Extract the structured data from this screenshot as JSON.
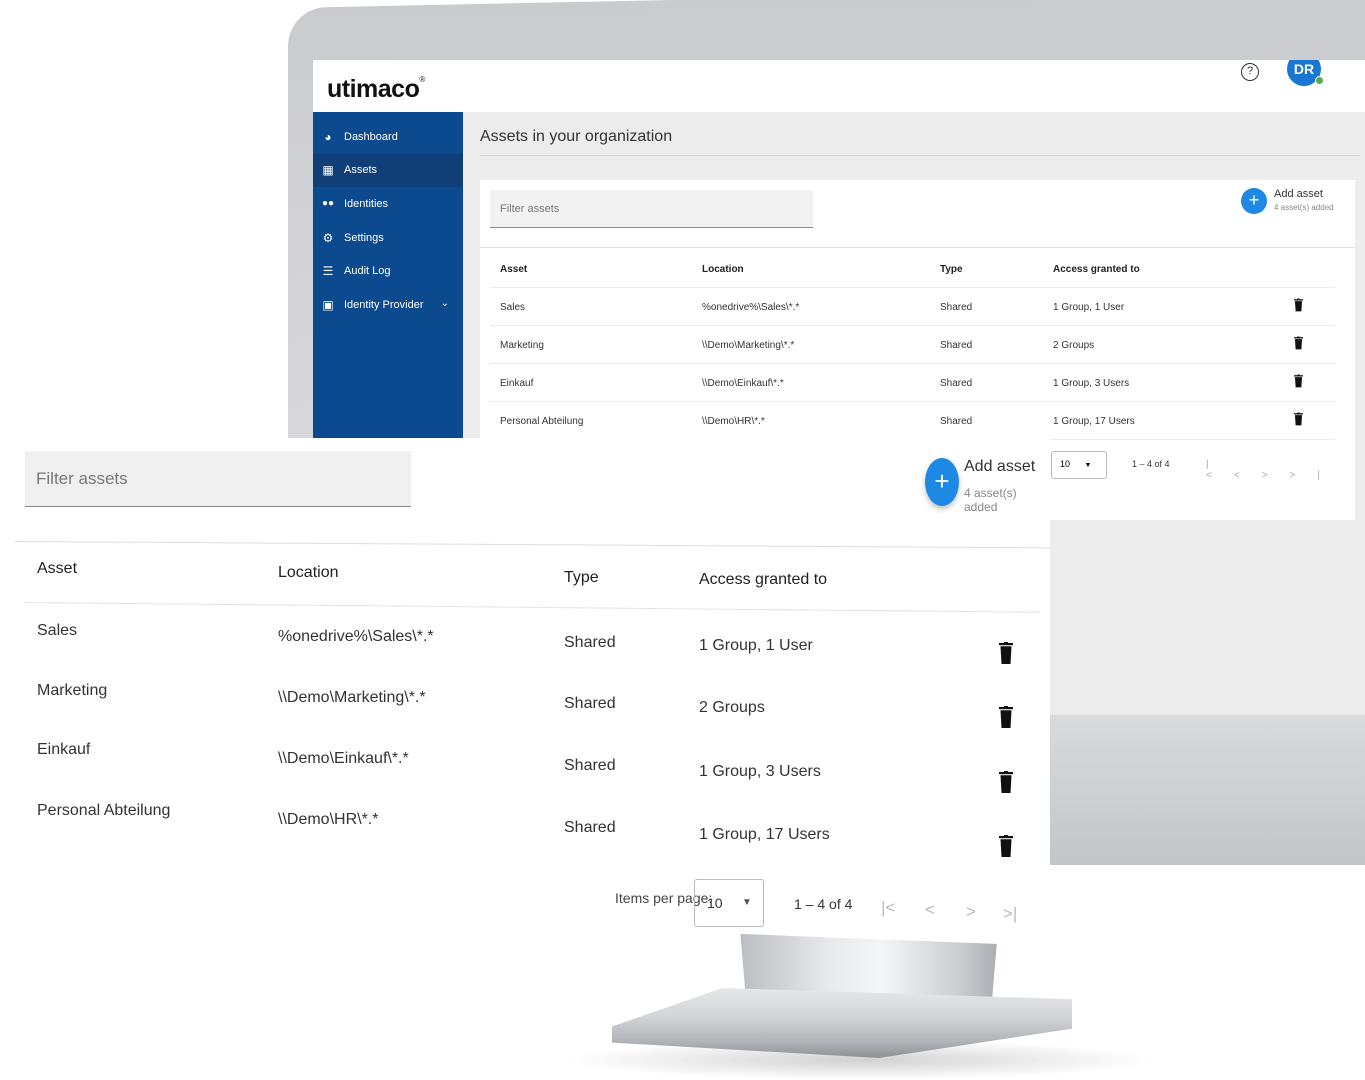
{
  "brand": {
    "name": "utimaco",
    "mark": "®"
  },
  "topbar": {
    "help_icon": "help-circle-icon",
    "avatar_initials": "DR",
    "status_color": "#4caf50"
  },
  "sidebar": {
    "items": [
      {
        "label": "Dashboard",
        "icon": "pie-chart-icon",
        "glyph": "◕"
      },
      {
        "label": "Assets",
        "icon": "assets-icon",
        "glyph": "▦",
        "active": true
      },
      {
        "label": "Identities",
        "icon": "people-icon",
        "glyph": "👥"
      },
      {
        "label": "Settings",
        "icon": "gear-icon",
        "glyph": "⚙"
      },
      {
        "label": "Audit Log",
        "icon": "list-icon",
        "glyph": "☰"
      },
      {
        "label": "Identity Provider",
        "icon": "id-badge-icon",
        "glyph": "▣",
        "chevron": "⌄"
      }
    ]
  },
  "page": {
    "title": "Assets in your organization"
  },
  "toolbar": {
    "filter_placeholder": "Filter assets",
    "add_label": "Add asset",
    "add_sub": "4 asset(s) added",
    "add_icon": "+"
  },
  "table": {
    "headers": [
      "Asset",
      "Location",
      "Type",
      "Access granted to"
    ],
    "rows": [
      {
        "asset": "Sales",
        "location": "%onedrive%\\Sales\\*.*",
        "type": "Shared",
        "access": "1 Group, 1 User"
      },
      {
        "asset": "Marketing",
        "location": "\\\\Demo\\Marketing\\*.*",
        "type": "Shared",
        "access": "2 Groups"
      },
      {
        "asset": "Einkauf",
        "location": "\\\\Demo\\Einkauf\\*.*",
        "type": "Shared",
        "access": "1 Group, 3 Users"
      },
      {
        "asset": "Personal Abteilung",
        "location": "\\\\Demo\\HR\\*.*",
        "type": "Shared",
        "access": "1 Group, 17 Users"
      }
    ]
  },
  "pagination": {
    "items_per_page_label": "Items per page:",
    "page_size": "10",
    "dropdown_arrow": "▼",
    "range": "1 – 4 of 4",
    "first_icon": "|<",
    "prev_icon": "<",
    "next_icon": ">",
    "last_icon": ">|"
  },
  "colors": {
    "primary": "#1e88e5",
    "sidebar": "#0b4a8f",
    "avatar": "#1976d2"
  }
}
